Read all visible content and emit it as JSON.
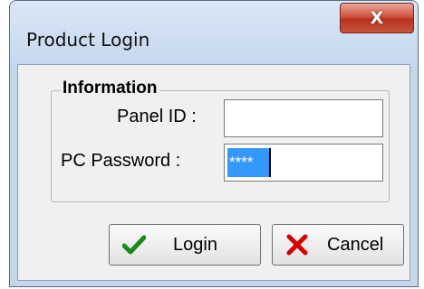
{
  "window": {
    "title": "Product Login",
    "close_label": "X"
  },
  "group": {
    "label": "Information"
  },
  "fields": {
    "panel_id_label": "Panel ID :",
    "panel_id_value": "",
    "pc_password_label": "PC Password :",
    "pc_password_value": "****"
  },
  "buttons": {
    "login_label": "Login",
    "cancel_label": "Cancel"
  },
  "icons": {
    "login": "checkmark-icon",
    "cancel": "x-icon"
  },
  "colors": {
    "checkmark": "#1a8a1a",
    "x_mark": "#d40000",
    "selection": "#3399ff",
    "close_button": "#c8432e"
  }
}
